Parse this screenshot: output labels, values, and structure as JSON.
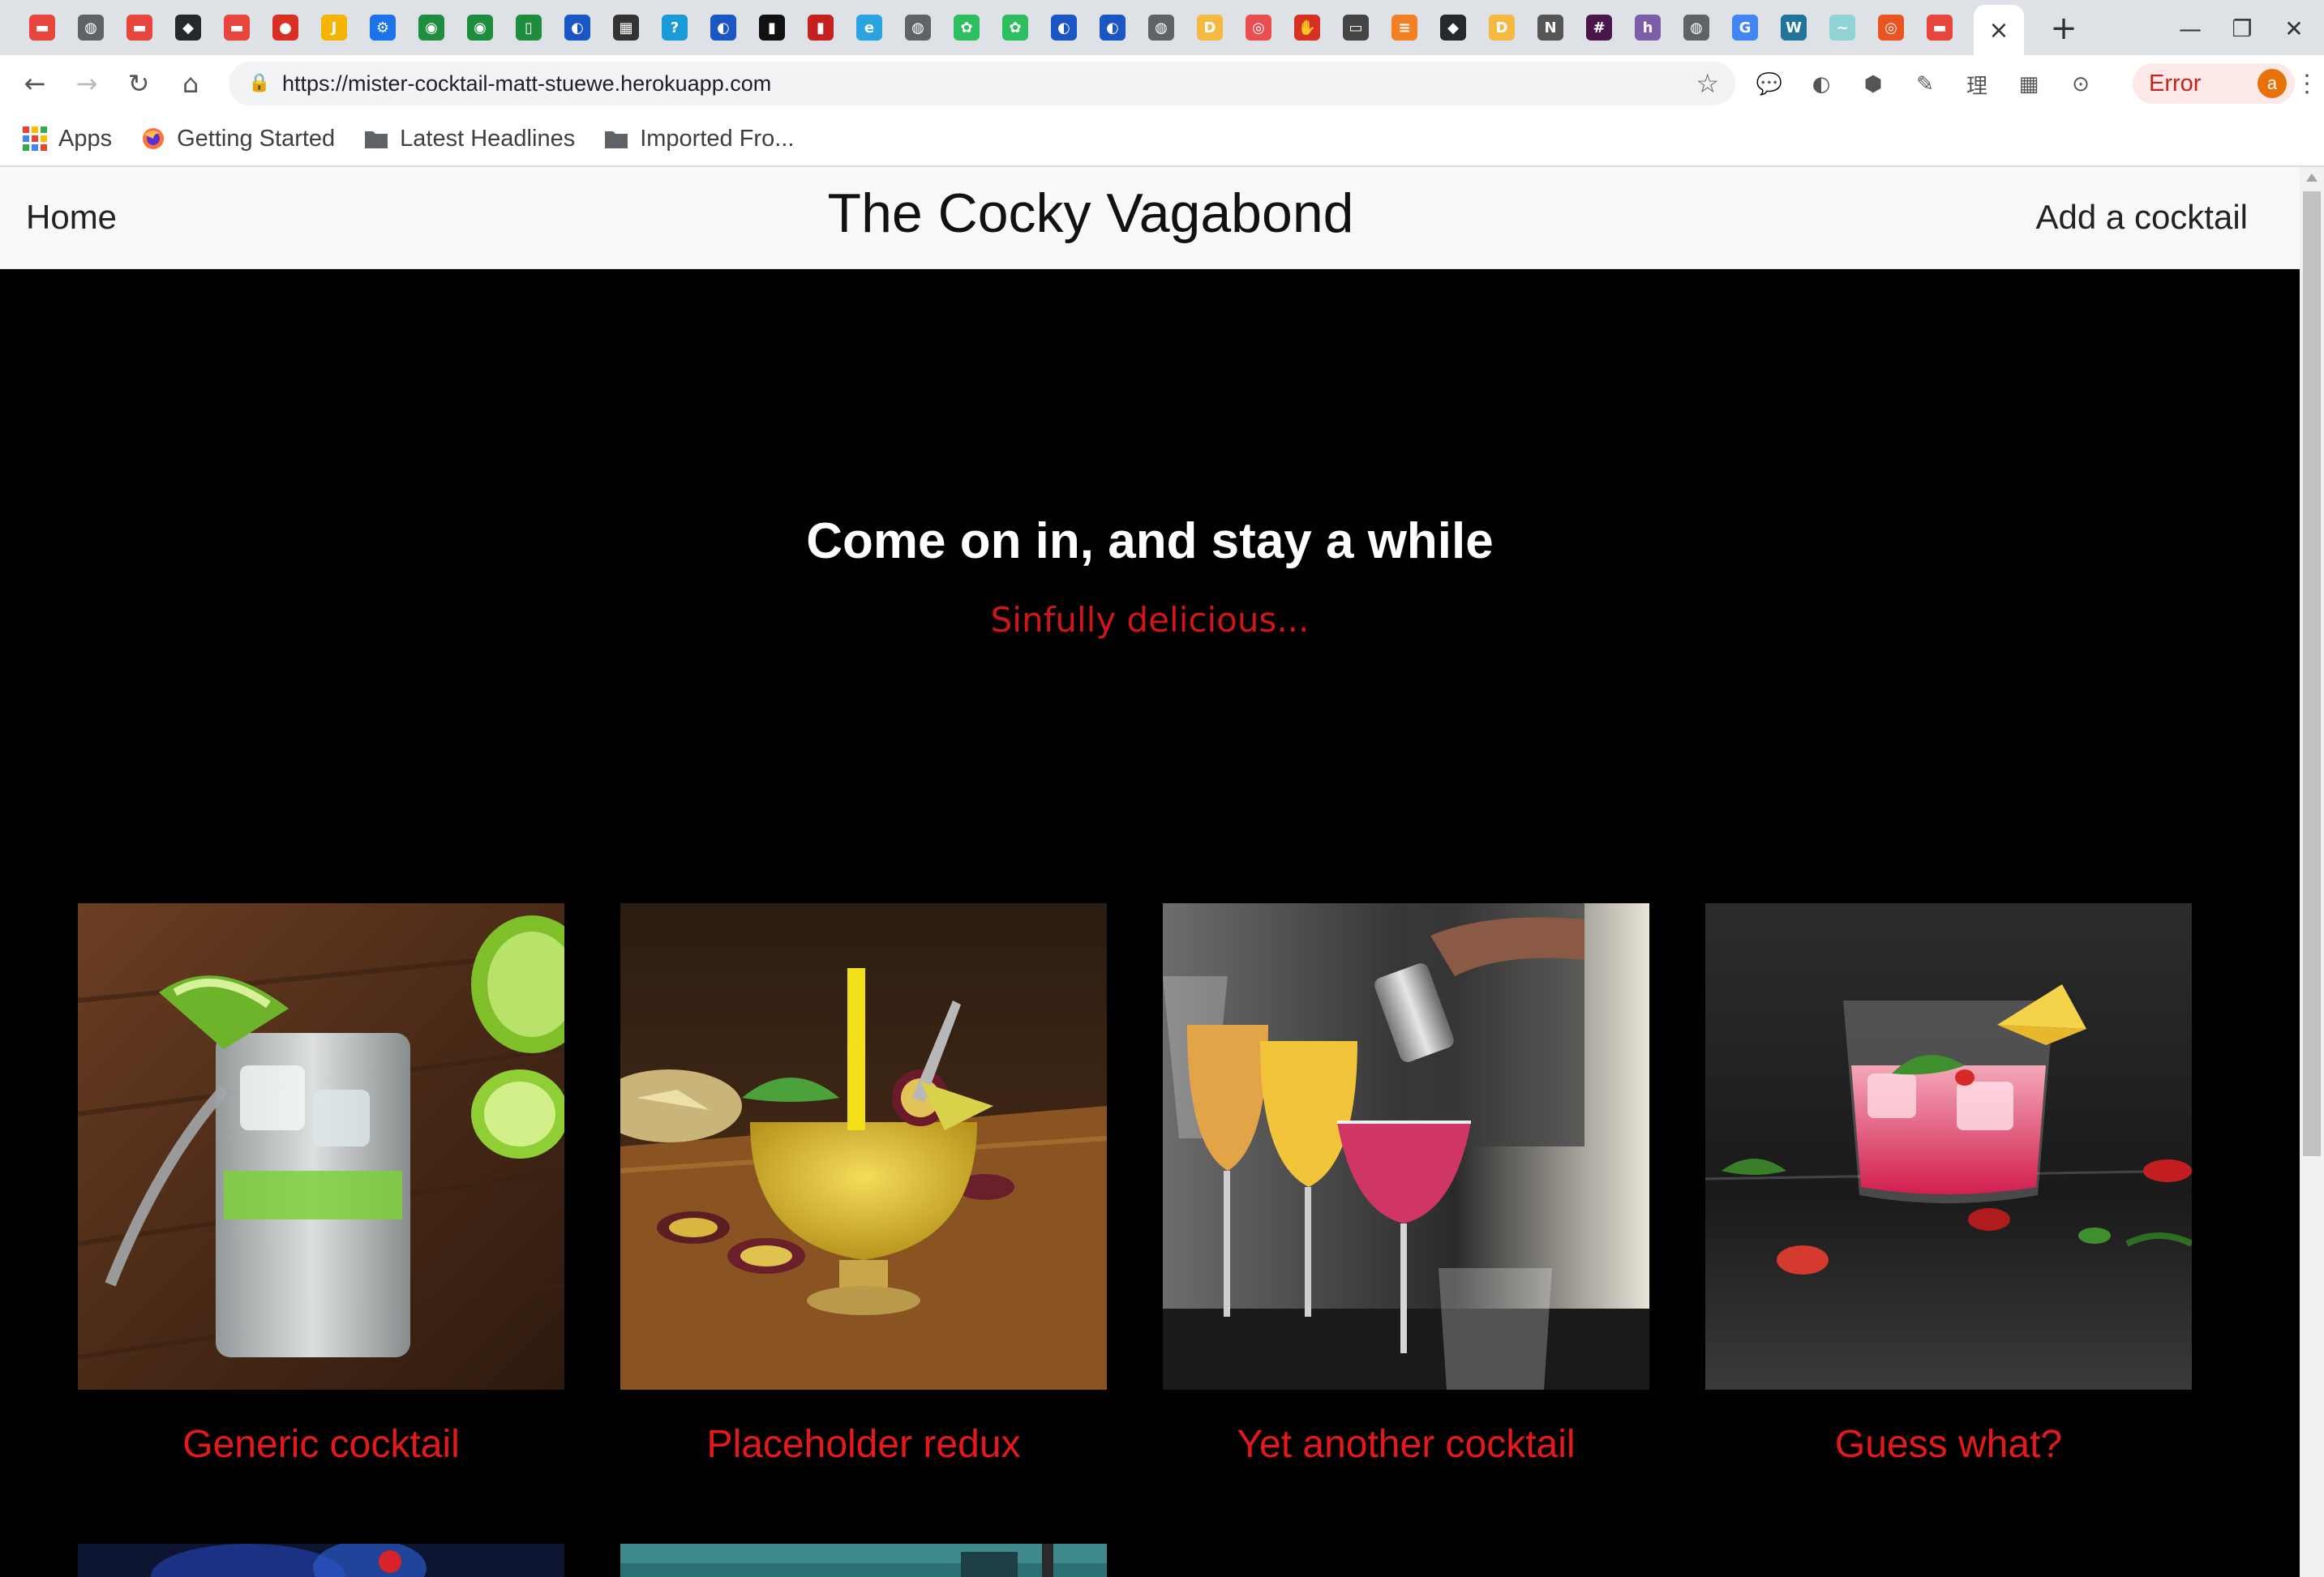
{
  "browser": {
    "active_tab_close": "×",
    "new_tab": "+",
    "window_controls": {
      "minimize": "—",
      "maximize": "❐",
      "close": "✕"
    },
    "nav": {
      "back": "←",
      "forward": "→",
      "reload": "↻",
      "home": "⌂"
    },
    "url": "https://mister-cocktail-matt-stuewe.herokuapp.com",
    "lock_icon": "🔒",
    "bookmark_star": "☆",
    "profile_error_label": "Error",
    "profile_avatar_letter": "a",
    "menu": "⋮",
    "extensions": [
      "💬",
      "◐",
      "⬢",
      "✎",
      "理",
      "▦",
      "⊙"
    ],
    "tab_favicons": [
      {
        "glyph": "▬",
        "bg": "#e8453c"
      },
      {
        "glyph": "◍",
        "bg": "#5f6368"
      },
      {
        "glyph": "▬",
        "bg": "#e8453c"
      },
      {
        "glyph": "◆",
        "bg": "#24292e"
      },
      {
        "glyph": "▬",
        "bg": "#e8453c"
      },
      {
        "glyph": "●",
        "bg": "#d93025"
      },
      {
        "glyph": "J",
        "bg": "#f4b400"
      },
      {
        "glyph": "⚙",
        "bg": "#1a73e8"
      },
      {
        "glyph": "◉",
        "bg": "#1e8e3e"
      },
      {
        "glyph": "◉",
        "bg": "#1e8e3e"
      },
      {
        "glyph": "▯",
        "bg": "#1e8e3e"
      },
      {
        "glyph": "◐",
        "bg": "#1a56c4"
      },
      {
        "glyph": "▦",
        "bg": "#333333"
      },
      {
        "glyph": "?",
        "bg": "#1a9bd7"
      },
      {
        "glyph": "◐",
        "bg": "#1a56c4"
      },
      {
        "glyph": "▮",
        "bg": "#111111"
      },
      {
        "glyph": "▮",
        "bg": "#c5221f"
      },
      {
        "glyph": "e",
        "bg": "#2ba3e0"
      },
      {
        "glyph": "◍",
        "bg": "#5f6368"
      },
      {
        "glyph": "✿",
        "bg": "#2dbe60"
      },
      {
        "glyph": "✿",
        "bg": "#2dbe60"
      },
      {
        "glyph": "◐",
        "bg": "#1a56c4"
      },
      {
        "glyph": "◐",
        "bg": "#1a56c4"
      },
      {
        "glyph": "◍",
        "bg": "#5f6368"
      },
      {
        "glyph": "D",
        "bg": "#f5b942"
      },
      {
        "glyph": "◎",
        "bg": "#e94e4e"
      },
      {
        "glyph": "✋",
        "bg": "#d93025"
      },
      {
        "glyph": "▭",
        "bg": "#444444"
      },
      {
        "glyph": "≡",
        "bg": "#f48024"
      },
      {
        "glyph": "◆",
        "bg": "#24292e"
      },
      {
        "glyph": "D",
        "bg": "#f5b942"
      },
      {
        "glyph": "N",
        "bg": "#555555"
      },
      {
        "glyph": "#",
        "bg": "#4a154b"
      },
      {
        "glyph": "h",
        "bg": "#7b5ea7"
      },
      {
        "glyph": "◍",
        "bg": "#5f6368"
      },
      {
        "glyph": "G",
        "bg": "#4285f4"
      },
      {
        "glyph": "W",
        "bg": "#21759b"
      },
      {
        "glyph": "~",
        "bg": "#8fd3d6"
      },
      {
        "glyph": "◎",
        "bg": "#e95420"
      },
      {
        "glyph": "▬",
        "bg": "#e8453c"
      }
    ]
  },
  "bookmarks": [
    {
      "label": "Apps",
      "icon": "apps-grid-icon"
    },
    {
      "label": "Getting Started",
      "icon": "firefox-icon"
    },
    {
      "label": "Latest Headlines",
      "icon": "folder-icon"
    },
    {
      "label": "Imported Fro...",
      "icon": "folder-icon"
    }
  ],
  "apps_grid_colors": [
    "#ea4335",
    "#fbbc04",
    "#34a853",
    "#4285f4",
    "#ea4335",
    "#fbbc04",
    "#34a853",
    "#4285f4",
    "#ea4335"
  ],
  "navbar": {
    "home": "Home",
    "title": "The Cocky Vagabond",
    "add": "Add a cocktail"
  },
  "hero": {
    "title": "Come on in, and stay a while",
    "subtitle": "Sinfully delicious..."
  },
  "cocktails": [
    {
      "name": "Generic cocktail",
      "image": "gin-tonic-lime-photo"
    },
    {
      "name": "Placeholder redux",
      "image": "passionfruit-cocktail-photo"
    },
    {
      "name": "Yet another cocktail",
      "image": "bartender-pouring-photo"
    },
    {
      "name": "Guess what?",
      "image": "red-cocktail-pineapple-photo"
    }
  ],
  "colors": {
    "accent_red": "#e5191c",
    "page_bg": "#000000",
    "navbar_bg": "#f8f9fa"
  }
}
